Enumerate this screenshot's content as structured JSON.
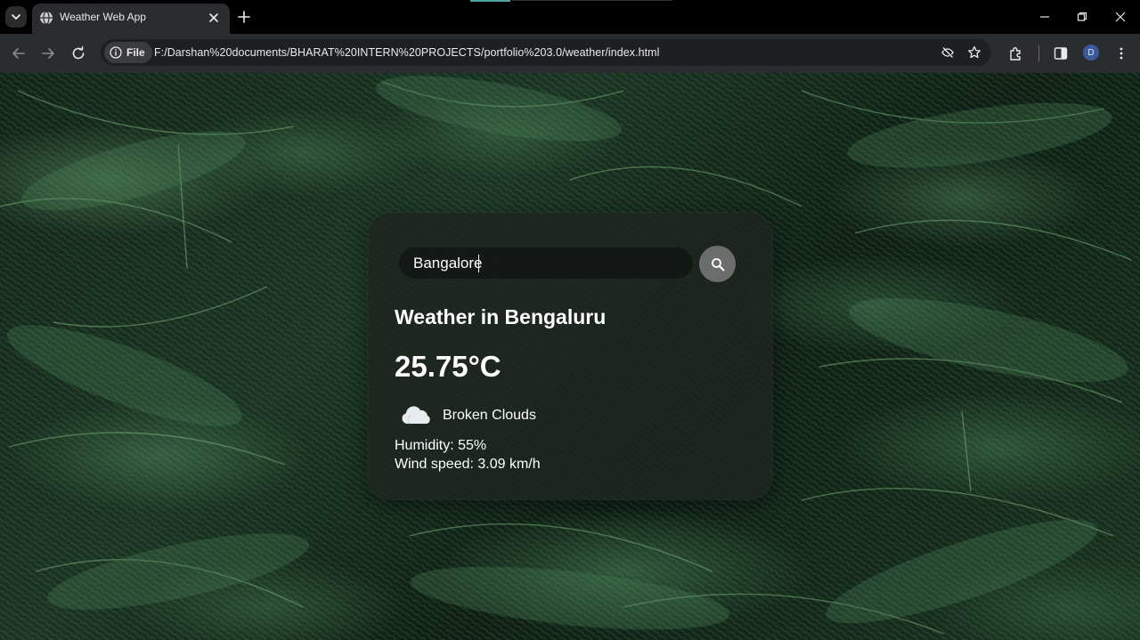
{
  "browser": {
    "tab": {
      "title": "Weather Web App",
      "favicon": "globe-icon"
    },
    "address": {
      "site_chip_label": "File",
      "url": "F:/Darshan%20documents/BHARAT%20INTERN%20PROJECTS/portfolio%203.0/weather/index.html"
    },
    "profile_initial": "D"
  },
  "weather_app": {
    "search": {
      "value": "Bangalore",
      "icon": "search-icon"
    },
    "city_heading": "Weather in Bengaluru",
    "temperature": "25.75°C",
    "condition": {
      "icon": "cloud-icon",
      "description": "Broken Clouds"
    },
    "humidity": "Humidity: 55%",
    "wind_speed": "Wind speed: 3.09 km/h"
  }
}
